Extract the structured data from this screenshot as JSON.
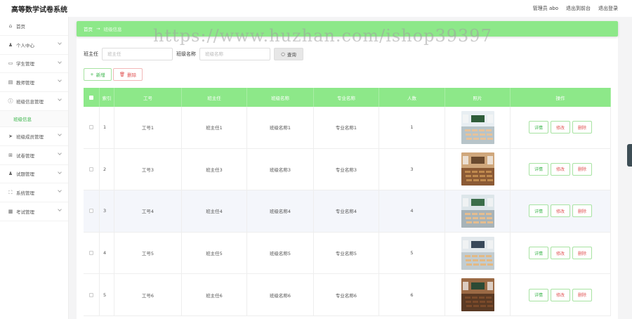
{
  "app": {
    "title": "高等数学试卷系统"
  },
  "header": {
    "user": "管理员 abo",
    "to_front": "退出到前台",
    "logout": "退出登录"
  },
  "sidebar": {
    "items": [
      {
        "label": "首页",
        "icon": "home-icon",
        "glyph": "⌂",
        "chevron": false
      },
      {
        "label": "个人中心",
        "icon": "user-icon",
        "glyph": "♟",
        "chevron": true
      },
      {
        "label": "学生管理",
        "icon": "id-card-icon",
        "glyph": "▭",
        "chevron": true
      },
      {
        "label": "教师管理",
        "icon": "document-icon",
        "glyph": "▤",
        "chevron": true
      },
      {
        "label": "班级信息管理",
        "icon": "info-icon",
        "glyph": "ⓘ",
        "chevron": true,
        "expanded": true
      },
      {
        "label": "班级成员管理",
        "icon": "send-icon",
        "glyph": "➤",
        "chevron": true
      },
      {
        "label": "试卷管理",
        "icon": "grid-icon",
        "glyph": "⊞",
        "chevron": true
      },
      {
        "label": "试题管理",
        "icon": "user-icon",
        "glyph": "♟",
        "chevron": true
      },
      {
        "label": "系统管理",
        "icon": "expand-icon",
        "glyph": "⛶",
        "chevron": true
      },
      {
        "label": "考试管理",
        "icon": "chart-icon",
        "glyph": "▦",
        "chevron": true
      }
    ],
    "submenu": {
      "label": "班级信息"
    }
  },
  "breadcrumb": {
    "home": "首页",
    "separator": "→",
    "current": "班级信息"
  },
  "watermark": "https://www.huzhan.com/ishop39397",
  "search": {
    "field1_label": "班主任",
    "field1_placeholder": "班主任",
    "field2_label": "班级名称",
    "field2_placeholder": "班级名称",
    "button": "查询"
  },
  "actions": {
    "add": "新增",
    "delete": "删除"
  },
  "table": {
    "headers": {
      "index": "索引",
      "no": "工号",
      "head_teacher": "班主任",
      "class_name": "班级名称",
      "major": "专业名称",
      "count": "人数",
      "image": "照片",
      "ops": "操作"
    },
    "ops": {
      "detail": "详情",
      "edit": "修改",
      "delete": "删除"
    },
    "rows": [
      {
        "index": "1",
        "no": "工号1",
        "head_teacher": "班主任1",
        "class_name": "班级名称1",
        "major": "专业名称1",
        "count": "1"
      },
      {
        "index": "2",
        "no": "工号3",
        "head_teacher": "班主任3",
        "class_name": "班级名称3",
        "major": "专业名称3",
        "count": "3"
      },
      {
        "index": "3",
        "no": "工号4",
        "head_teacher": "班主任4",
        "class_name": "班级名称4",
        "major": "专业名称4",
        "count": "4"
      },
      {
        "index": "4",
        "no": "工号5",
        "head_teacher": "班主任5",
        "class_name": "班级名称5",
        "major": "专业名称5",
        "count": "5"
      },
      {
        "index": "5",
        "no": "工号6",
        "head_teacher": "班主任6",
        "class_name": "班级名称6",
        "major": "专业名称6",
        "count": "6"
      }
    ]
  },
  "colors": {
    "accent": "#8de889",
    "primary_text": "#3ab54a",
    "danger": "#e05353"
  }
}
